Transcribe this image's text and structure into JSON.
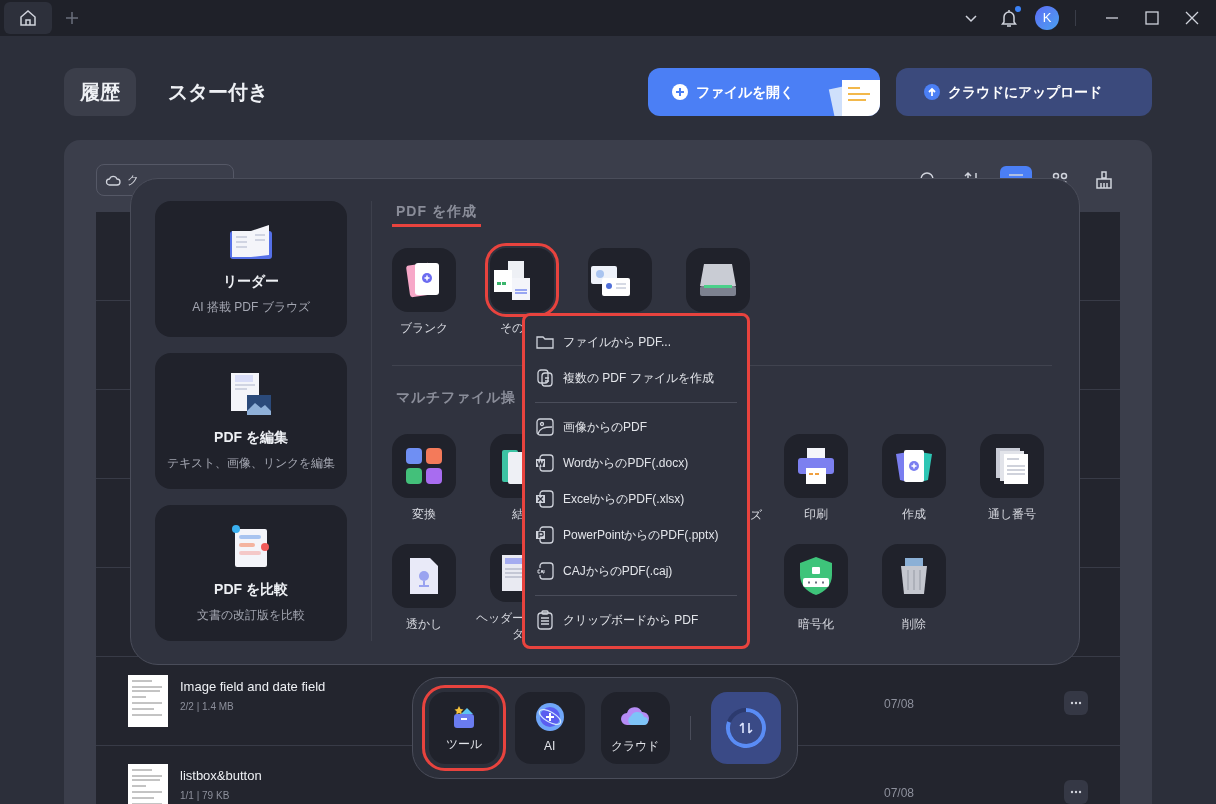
{
  "avatar": "K",
  "notification_dot": true,
  "tabs": [
    {
      "label": "履歴",
      "selected": true
    },
    {
      "label": "スター付き",
      "selected": false
    }
  ],
  "actions": [
    {
      "label": "ファイルを開く",
      "kind": "primary"
    },
    {
      "label": "クラウドにアップロード",
      "kind": "secondary"
    }
  ],
  "filter": {
    "label": "ク"
  },
  "view_toolbar": [
    {
      "kind": "search",
      "selected": false
    },
    {
      "kind": "sort",
      "selected": false
    },
    {
      "kind": "list",
      "selected": true
    },
    {
      "kind": "grid",
      "selected": false
    },
    {
      "kind": "clean",
      "selected": false
    }
  ],
  "files": [
    {
      "name": "Image field and date field",
      "meta": "2/2 | 1.4 MB",
      "date": "07/08"
    },
    {
      "name": "listbox&button",
      "meta": "1/1 | 79 KB",
      "date": "07/08"
    }
  ],
  "tools_popup": {
    "features": [
      {
        "kind": "reader",
        "title": "リーダー",
        "subtitle": "AI 搭載 PDF ブラウズ"
      },
      {
        "kind": "edit",
        "title": "PDF を編集",
        "subtitle": "テキスト、画像、リンクを編集"
      },
      {
        "kind": "compare",
        "title": "PDF を比較",
        "subtitle": "文書の改訂版を比較"
      }
    ],
    "sections": [
      {
        "title": "PDF を作成",
        "highlighted": true,
        "rows": [
          [
            {
              "kind": "blank",
              "label": "ブランク",
              "highlighted": false
            },
            {
              "kind": "others",
              "label": "その",
              "highlighted": true
            },
            {
              "kind": "id",
              "highlighted": false
            },
            {
              "kind": "scanner",
              "highlighted": false
            }
          ]
        ]
      },
      {
        "title": "マルチファイル操",
        "highlighted": false,
        "rows": [
          [
            {
              "kind": "convert",
              "label": "変換",
              "highlighted": false
            },
            {
              "kind": "merge",
              "label": "結",
              "highlighted": false
            },
            {
              "kind": "covered"
            },
            {
              "kind": "covered",
              "label": "ズ"
            },
            {
              "kind": "print",
              "label": "印刷",
              "highlighted": false
            },
            {
              "kind": "create",
              "label": "作成",
              "highlighted": false
            },
            {
              "kind": "bates",
              "label": "通し番号",
              "highlighted": false
            }
          ],
          [
            {
              "kind": "watermark",
              "label": "透かし",
              "highlighted": false
            },
            {
              "kind": "header",
              "label": "ヘッダー",
              "label_line_2": "タ",
              "highlighted": false
            },
            {
              "kind": "covered"
            },
            {
              "kind": "covered"
            },
            {
              "kind": "encrypt",
              "label": "暗号化",
              "highlighted": false
            },
            {
              "kind": "delete",
              "label": "削除",
              "highlighted": false
            }
          ]
        ]
      }
    ]
  },
  "menu": {
    "highlighted": true,
    "groups": [
      [
        {
          "kind": "folder",
          "label": "ファイルから PDF..."
        },
        {
          "kind": "copies",
          "label": "複数の PDF ファイルを作成"
        }
      ],
      [
        {
          "kind": "image",
          "label": "画像からのPDF"
        },
        {
          "kind": "word",
          "label": "WordからのPDF(.docx)"
        },
        {
          "kind": "excel",
          "label": "ExcelからのPDF(.xlsx)"
        },
        {
          "kind": "powerpoint",
          "label": "PowerPointからのPDF(.pptx)"
        },
        {
          "kind": "caj",
          "label": "CAJからのPDF(.caj)"
        }
      ],
      [
        {
          "kind": "clipboard",
          "label": "クリップボードから PDF"
        }
      ]
    ]
  },
  "dock": {
    "items": [
      {
        "kind": "tools",
        "label": "ツール",
        "highlighted": true
      },
      {
        "kind": "ai",
        "label": "AI",
        "highlighted": false
      },
      {
        "kind": "cloud",
        "label": "クラウド",
        "highlighted": false
      }
    ]
  }
}
